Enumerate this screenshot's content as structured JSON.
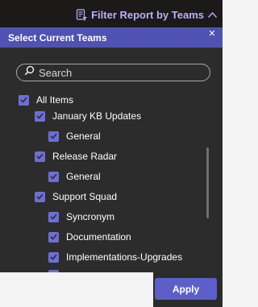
{
  "header": {
    "filter_label": "Filter Report by Teams",
    "filter_icon": "filter-list-icon",
    "chevron_icon": "chevron-up-icon"
  },
  "panel": {
    "title": "Select Current Teams",
    "close_icon": "close-icon",
    "close_glyph": "✕"
  },
  "search": {
    "placeholder": "Search",
    "value": "",
    "icon": "search-icon"
  },
  "tree": {
    "items": [
      {
        "label": "All Items",
        "level": 0,
        "checked": true
      },
      {
        "label": "January KB Updates",
        "level": 1,
        "checked": true
      },
      {
        "label": "General",
        "level": 2,
        "checked": true
      },
      {
        "label": "Release Radar",
        "level": 1,
        "checked": true
      },
      {
        "label": "General",
        "level": 2,
        "checked": true
      },
      {
        "label": "Support Squad",
        "level": 1,
        "checked": true
      },
      {
        "label": "Syncronym",
        "level": 2,
        "checked": true
      },
      {
        "label": "Documentation",
        "level": 2,
        "checked": true
      },
      {
        "label": "Implementations-Upgrades",
        "level": 2,
        "checked": true
      }
    ]
  },
  "footer": {
    "apply_label": "Apply"
  },
  "colors": {
    "accent": "#5b5fc7",
    "header_bg": "#4f52b2",
    "checkbox": "#6c6fd6",
    "filter_text": "#b6b0ff",
    "panel_bg": "#2d2c2c"
  }
}
